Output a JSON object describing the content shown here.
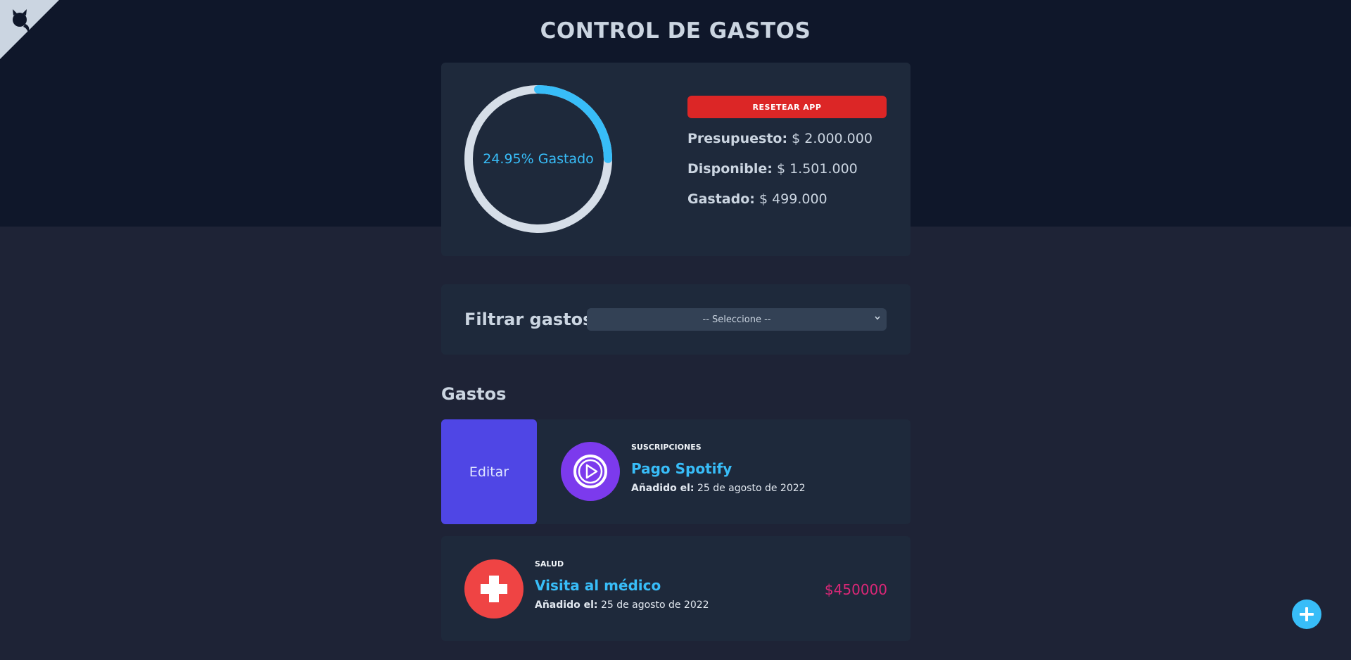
{
  "app": {
    "title": "CONTROL DE GASTOS"
  },
  "budget": {
    "percent_spent": 24.95,
    "percent_label": "24.95% Gastado",
    "reset_label": "RESETEAR APP",
    "presupuesto_label": "Presupuesto:",
    "presupuesto_value": "$ 2.000.000",
    "disponible_label": "Disponible:",
    "disponible_value": "$ 1.501.000",
    "gastado_label": "Gastado:",
    "gastado_value": "$ 499.000"
  },
  "filter": {
    "label": "Filtrar gastos",
    "selected": "-- Seleccione --"
  },
  "expenses": {
    "title": "Gastos",
    "edit_label": "Editar",
    "items": [
      {
        "category": "SUSCRIPCIONES",
        "name": "Pago Spotify",
        "date_label": "Añadido el:",
        "date": "25 de agosto de 2022",
        "amount": "",
        "icon": "play-icon"
      },
      {
        "category": "SALUD",
        "name": "Visita al médico",
        "date_label": "Añadido el:",
        "date": "25 de agosto de 2022",
        "amount": "$450000",
        "icon": "medical-cross-icon"
      }
    ]
  },
  "colors": {
    "accent": "#38bdf8",
    "danger": "#dc2626",
    "edit": "#4f46e5",
    "subscription_icon": "#7c3aed",
    "health_icon": "#ef4444",
    "amount": "#db2777"
  },
  "icons": {
    "corner": "github-octocat-icon",
    "fab": "plus-icon"
  }
}
